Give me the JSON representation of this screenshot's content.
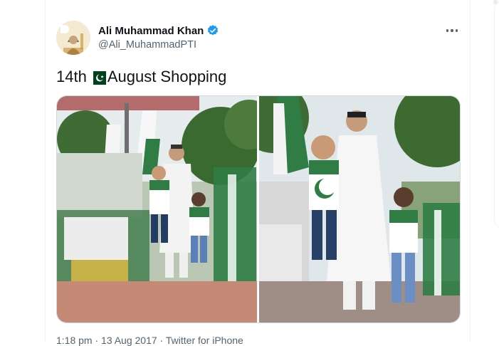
{
  "tweet": {
    "author_name": "Ali Muhammad Khan",
    "author_handle": "@Ali_MuhammadPTI",
    "text_before": "14th",
    "text_after": "August Shopping",
    "flag_emoji": "pakistan-flag",
    "timestamp": "1:18 pm · 13 Aug 2017",
    "separator": " · ",
    "source": "Twitter for iPhone"
  },
  "colors": {
    "verified": "#1d9bf0",
    "text_primary": "#0f1419",
    "text_secondary": "#536471",
    "border": "#cfd9de",
    "flag_green": "#01411c"
  },
  "icons": [
    "verified-badge-icon",
    "more-options-icon",
    "pakistan-flag-icon"
  ]
}
